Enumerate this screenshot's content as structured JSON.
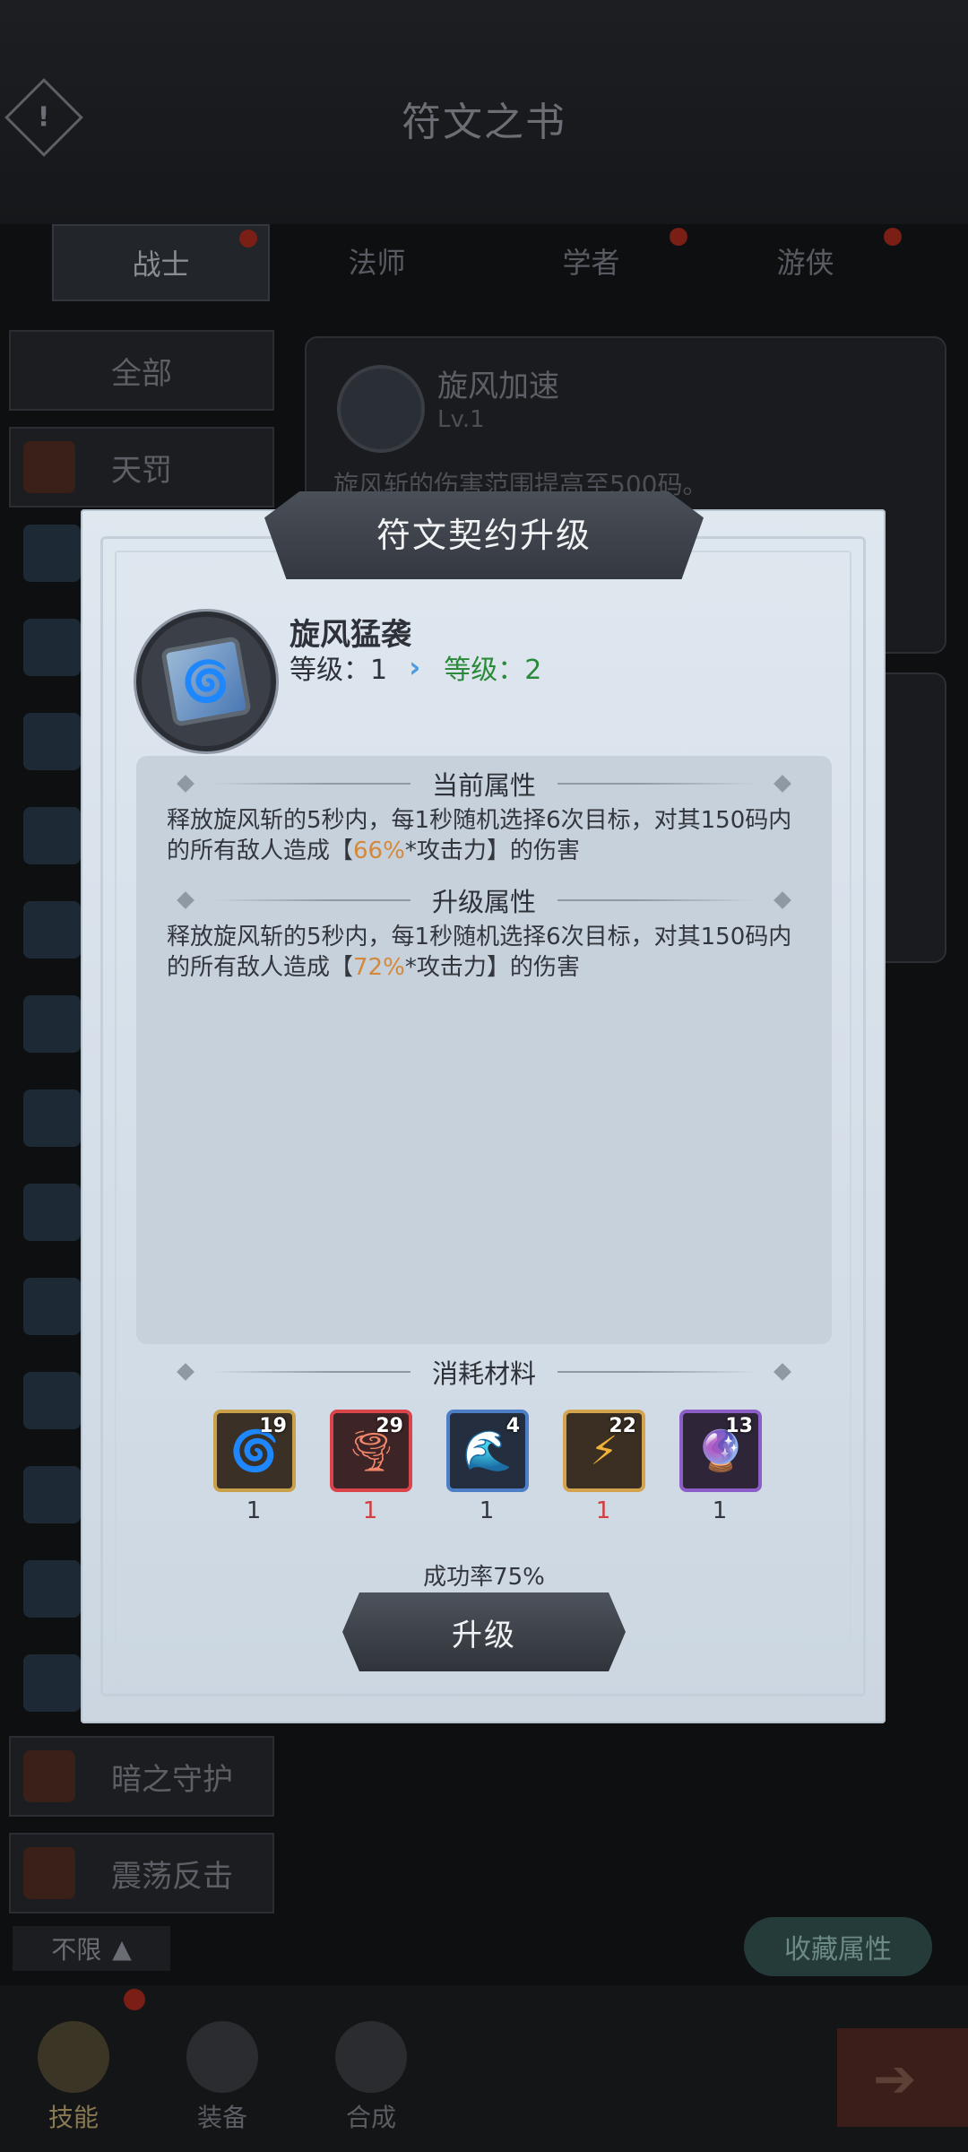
{
  "header": {
    "title": "符文之书",
    "alert_glyph": "!"
  },
  "tabs": [
    {
      "label": "战士"
    },
    {
      "label": "法师"
    },
    {
      "label": "学者"
    },
    {
      "label": "游侠"
    }
  ],
  "sidebar": {
    "all_label": "全部",
    "first_item": "天罚",
    "bottom_items": [
      {
        "label": "暗之守护"
      },
      {
        "label": "震荡反击"
      }
    ]
  },
  "bg_card": {
    "name": "旋风加速",
    "level": "Lv.1",
    "desc": "旋风斩的伤害范围提高至500码。"
  },
  "bottom_bar": {
    "filter_label": "不限",
    "filter_icon": "triangle-up-icon",
    "collect_label": "收藏属性",
    "nav": [
      {
        "label": "技能",
        "icon": "sword-icon"
      },
      {
        "label": "装备",
        "icon": "cards-icon"
      },
      {
        "label": "合成",
        "icon": "swirl-icon"
      }
    ],
    "go_glyph": "➔"
  },
  "modal": {
    "title": "符文契约升级",
    "skill_name": "旋风猛袭",
    "skill_glyph": "🌀",
    "level_current": "等级：1",
    "level_arrow": "›",
    "level_next": "等级：2",
    "current_header": "当前属性",
    "current_desc_a": "释放旋风斩的5秒内，每1秒随机选择6次目标，对其150码内的所有敌人造成【",
    "current_pct": "66%",
    "current_desc_b": "*攻击力】的伤害",
    "upgrade_header": "升级属性",
    "upgrade_desc_a": "释放旋风斩的5秒内，每1秒随机选择6次目标，对其150码内的所有敌人造成【",
    "upgrade_pct": "72%",
    "upgrade_desc_b": "*攻击力】的伤害",
    "materials_header": "消耗材料",
    "materials": [
      {
        "count": "19",
        "need": "1",
        "glyph": "🌀",
        "icon": "gold-rune-icon"
      },
      {
        "count": "29",
        "need": "1",
        "glyph": "🌪",
        "icon": "red-rune-icon"
      },
      {
        "count": "4",
        "need": "1",
        "glyph": "🌊",
        "icon": "blue-rune-icon"
      },
      {
        "count": "22",
        "need": "1",
        "glyph": "⚡",
        "icon": "amber-rune-icon"
      },
      {
        "count": "13",
        "need": "1",
        "glyph": "🔮",
        "icon": "purple-rune-icon"
      }
    ],
    "success_rate": "成功率75%",
    "upgrade_button": "升级"
  }
}
